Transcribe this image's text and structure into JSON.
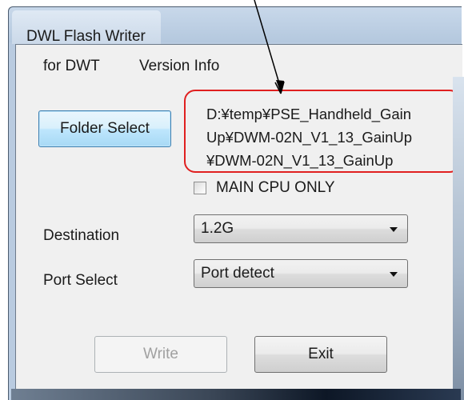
{
  "window": {
    "title": "DWL Flash Writer"
  },
  "menu": {
    "items": [
      {
        "label": "for DWT"
      },
      {
        "label": "Version Info"
      }
    ]
  },
  "folder_select": {
    "label": "Folder Select"
  },
  "path": {
    "lines": [
      "D:¥temp¥PSE_Handheld_Gain",
      "Up¥DWM-02N_V1_13_GainUp",
      "¥DWM-02N_V1_13_GainUp"
    ]
  },
  "main_cpu_only": {
    "label": "MAIN CPU ONLY",
    "checked": false
  },
  "destination": {
    "label": "Destination",
    "value": "1.2G"
  },
  "port_select": {
    "label": "Port Select",
    "value": "Port detect"
  },
  "actions": {
    "write_label": "Write",
    "write_enabled": false,
    "exit_label": "Exit"
  },
  "colors": {
    "annotation_highlight": "#e02020",
    "annotation_arrow": "#000000"
  }
}
